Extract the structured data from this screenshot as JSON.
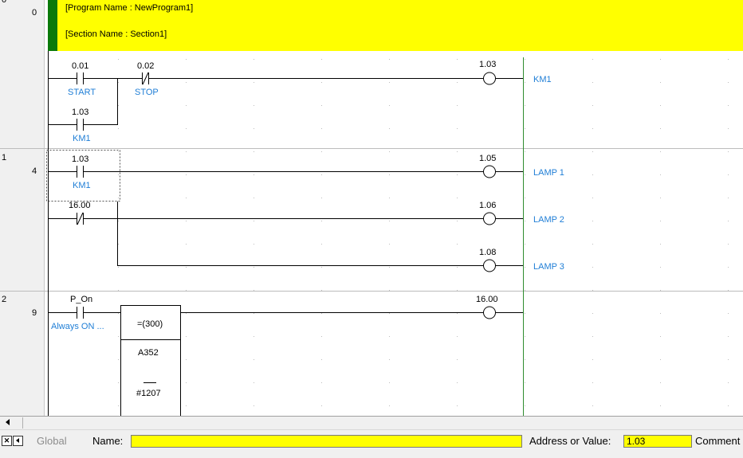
{
  "section_header": {
    "program_name": "[Program Name : NewProgram1]",
    "section_name": "[Section Name : Section1]"
  },
  "rungs": [
    {
      "rung_number": "0",
      "step": "0"
    },
    {
      "rung_number": "1",
      "step": "4"
    },
    {
      "rung_number": "2",
      "step": "9"
    }
  ],
  "rung0": {
    "start_addr": "0.01",
    "start_comment": "START",
    "stop_addr": "0.02",
    "stop_comment": "STOP",
    "hold_addr": "1.03",
    "hold_comment": "KM1",
    "coil_addr": "1.03",
    "coil_comment": "KM1"
  },
  "rung1": {
    "contact1_addr": "1.03",
    "contact1_comment": "KM1",
    "contact2_addr": "16.00",
    "coil1_addr": "1.05",
    "coil1_comment": "LAMP 1",
    "coil2_addr": "1.06",
    "coil2_comment": "LAMP 2",
    "coil3_addr": "1.08",
    "coil3_comment": "LAMP 3"
  },
  "rung2": {
    "contact_addr": "P_On",
    "contact_comment": "Always ON ...",
    "func_name": "=(300)",
    "func_op1": "A352",
    "func_op2": "#1207",
    "coil_addr": "16.00"
  },
  "status": {
    "global": "Global",
    "name_label": "Name:",
    "name_value": "",
    "address_label": "Address or Value:",
    "address_value": "1.03",
    "comment_label": "Comment"
  },
  "colors": {
    "comment_bg": "#ffff00",
    "comment_bar": "#0a7a0a",
    "comment_text": "#1f7ed6",
    "right_rail": "#2e8b2e",
    "input_bg": "#ffff00"
  },
  "icons": {
    "close": "close-icon",
    "dock": "dock-icon",
    "scroll_left": "arrow-left-icon"
  }
}
